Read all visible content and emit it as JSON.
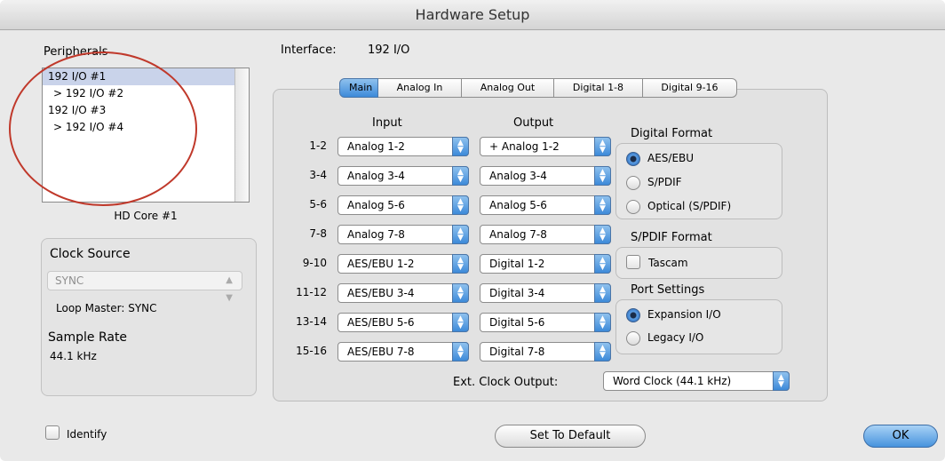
{
  "window": {
    "title": "Hardware Setup"
  },
  "peripherals": {
    "title": "Peripherals",
    "items": [
      {
        "label": "192 I/O #1",
        "selected": true,
        "indent": false
      },
      {
        "label": "> 192 I/O #2",
        "selected": false,
        "indent": true
      },
      {
        "label": "192 I/O #3",
        "selected": false,
        "indent": false
      },
      {
        "label": "> 192 I/O #4",
        "selected": false,
        "indent": true
      }
    ],
    "core_label": "HD Core #1",
    "highlight_color": "#c0392b"
  },
  "clock": {
    "title": "Clock Source",
    "source_value": "SYNC",
    "loop_master": "Loop Master: SYNC",
    "rate_title": "Sample Rate",
    "rate_value": "44.1 kHz"
  },
  "interface": {
    "label": "Interface:",
    "value": "192 I/O"
  },
  "tabs": [
    {
      "label": "Main",
      "active": true
    },
    {
      "label": "Analog In",
      "active": false
    },
    {
      "label": "Analog Out",
      "active": false
    },
    {
      "label": "Digital 1-8",
      "active": false
    },
    {
      "label": "Digital 9-16",
      "active": false
    }
  ],
  "routing": {
    "input_header": "Input",
    "output_header": "Output",
    "rows": [
      {
        "channel": "1-2",
        "input": "Analog 1-2",
        "output": "+ Analog 1-2"
      },
      {
        "channel": "3-4",
        "input": "Analog 3-4",
        "output": "Analog 3-4"
      },
      {
        "channel": "5-6",
        "input": "Analog 5-6",
        "output": "Analog 5-6"
      },
      {
        "channel": "7-8",
        "input": "Analog 7-8",
        "output": "Analog 7-8"
      },
      {
        "channel": "9-10",
        "input": "AES/EBU 1-2",
        "output": "Digital 1-2"
      },
      {
        "channel": "11-12",
        "input": "AES/EBU 3-4",
        "output": "Digital 3-4"
      },
      {
        "channel": "13-14",
        "input": "AES/EBU 5-6",
        "output": "Digital 5-6"
      },
      {
        "channel": "15-16",
        "input": "AES/EBU 7-8",
        "output": "Digital 7-8"
      }
    ]
  },
  "digital_format": {
    "title": "Digital Format",
    "options": [
      {
        "label": "AES/EBU",
        "selected": true
      },
      {
        "label": "S/PDIF",
        "selected": false
      },
      {
        "label": "Optical (S/PDIF)",
        "selected": false
      }
    ]
  },
  "spdif_format": {
    "title": "S/PDIF Format",
    "tascam_label": "Tascam",
    "tascam_checked": false
  },
  "port_settings": {
    "title": "Port Settings",
    "options": [
      {
        "label": "Expansion I/O",
        "selected": true
      },
      {
        "label": "Legacy I/O",
        "selected": false
      }
    ]
  },
  "ext_clock": {
    "label": "Ext. Clock Output:",
    "value": "Word Clock (44.1 kHz)"
  },
  "footer": {
    "identify_label": "Identify",
    "identify_checked": false,
    "default_button": "Set To Default",
    "ok_button": "OK"
  },
  "colors": {
    "accent": "#3d8ad9",
    "window_bg": "#e9e9e9"
  },
  "icons": {
    "popup_arrows": "up-down-arrows-icon",
    "clock_arrows": "up-down-arrows-icon"
  }
}
